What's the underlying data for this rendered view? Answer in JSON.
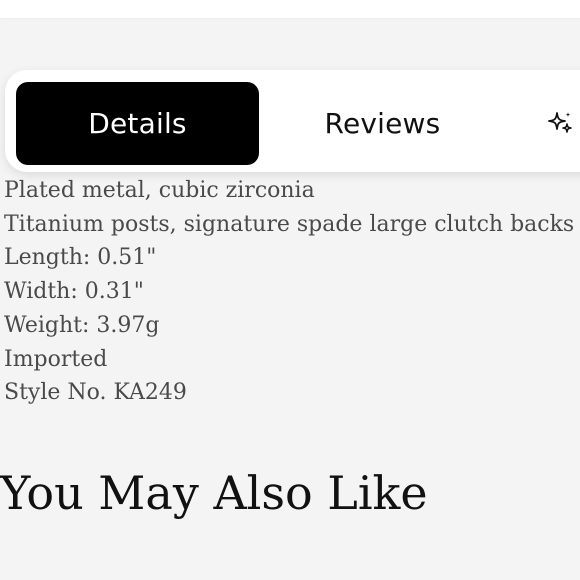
{
  "tabs": {
    "details_label": "Details",
    "reviews_label": "Reviews",
    "ai_icon": "sparkle-icon",
    "active_tab": "Details",
    "active_bg": "#000000",
    "active_fg": "#ffffff"
  },
  "details": {
    "items": [
      "Plated metal, cubic zirconia",
      "Titanium posts, signature spade large clutch backs",
      "Length: 0.51\"",
      "Width: 0.31\"",
      "Weight: 3.97g",
      "Imported",
      "Style No. KA249"
    ]
  },
  "recommendations": {
    "heading": "You May Also Like"
  }
}
